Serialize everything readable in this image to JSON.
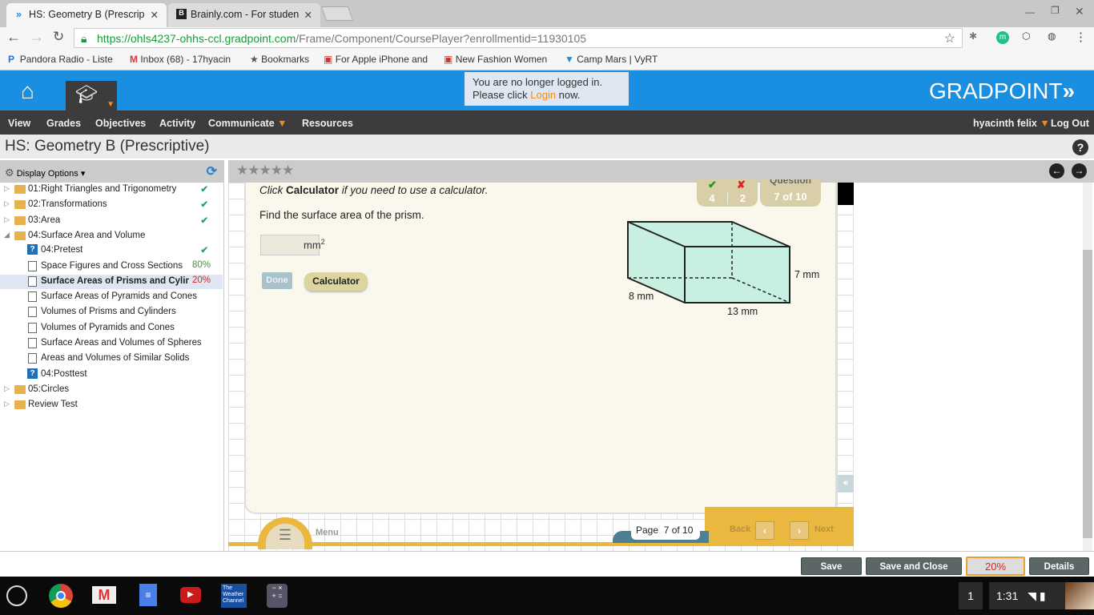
{
  "browser": {
    "tabs": [
      {
        "label": "HS: Geometry B (Prescrip",
        "active": true
      },
      {
        "label": "Brainly.com - For studen",
        "active": false
      }
    ],
    "url_host": "https://ohls4237-ohhs-ccl.gradpoint.com",
    "url_path": "/Frame/Component/CoursePlayer?enrollmentid=11930105",
    "bookmarks": [
      "Pandora Radio - Liste",
      "Inbox (68) - 17hyacin",
      "Bookmarks",
      "For Apple iPhone and",
      "New Fashion Women",
      "Camp Mars | VyRT"
    ]
  },
  "header": {
    "logo": "GRADPOINT",
    "notice_line1": "You are no longer logged in.",
    "notice_line2_pre": "Please click ",
    "notice_link": "Login",
    "notice_line2_post": " now."
  },
  "nav": {
    "items": [
      "View",
      "Grades",
      "Objectives",
      "Activity",
      "Communicate",
      "Resources"
    ],
    "user": "hyacinth felix",
    "logout": "Log Out"
  },
  "page_title": "HS: Geometry B (Prescriptive)",
  "sidebar": {
    "display_options": "Display Options",
    "items": [
      {
        "label": "01:Right Triangles and Trigonometry",
        "type": "folder",
        "status": "✔"
      },
      {
        "label": "02:Transformations",
        "type": "folder",
        "status": "✔"
      },
      {
        "label": "03:Area",
        "type": "folder",
        "status": "✔"
      },
      {
        "label": "04:Surface Area and Volume",
        "type": "folder-open",
        "status": ""
      },
      {
        "label": "04:Pretest",
        "type": "quiz",
        "status": "✔"
      },
      {
        "label": "Space Figures and Cross Sections",
        "type": "doc",
        "status": "80%"
      },
      {
        "label": "Surface Areas of Prisms and Cylinders",
        "type": "doc",
        "status": "20%",
        "selected": true
      },
      {
        "label": "Surface Areas of Pyramids and Cones",
        "type": "doc",
        "status": ""
      },
      {
        "label": "Volumes of Prisms and Cylinders",
        "type": "doc",
        "status": ""
      },
      {
        "label": "Volumes of Pyramids and Cones",
        "type": "doc",
        "status": ""
      },
      {
        "label": "Surface Areas and Volumes of Spheres",
        "type": "doc",
        "status": ""
      },
      {
        "label": "Areas and Volumes of Similar Solids",
        "type": "doc",
        "status": ""
      },
      {
        "label": "04:Posttest",
        "type": "quiz",
        "status": ""
      },
      {
        "label": "05:Circles",
        "type": "folder",
        "status": ""
      },
      {
        "label": "Review Test",
        "type": "folder",
        "status": ""
      }
    ]
  },
  "question": {
    "instr_pre": "Click ",
    "instr_bold": "Calculator",
    "instr_post": " if you need to use a calculator.",
    "prompt": "Find the surface area of the prism.",
    "answer_value": "",
    "unit": "mm",
    "unit_exp": "2",
    "done": "Done",
    "calculator": "Calculator",
    "correct_count": "4",
    "wrong_count": "2",
    "question_label": "Question",
    "question_pos": "7 of 10",
    "dims": {
      "height": "7 mm",
      "depth": "8 mm",
      "width": "13 mm"
    }
  },
  "footer": {
    "menu": "Menu",
    "page_label": "Page",
    "page_pos": "7 of 10",
    "back": "Back",
    "next": "Next"
  },
  "bottom": {
    "save": "Save",
    "save_close": "Save and Close",
    "progress": "20%",
    "details": "Details"
  },
  "taskbar": {
    "weather": "The Weather Channel",
    "notif": "1",
    "time": "1:31"
  },
  "colors": {
    "brand": "#1a8ee0",
    "check": "#2e9e6a",
    "fail": "#e02020",
    "prism": "#c8f0e0"
  }
}
